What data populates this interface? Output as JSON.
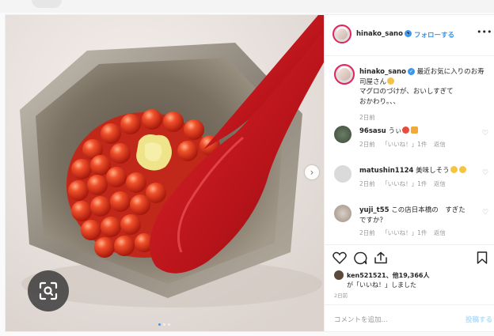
{
  "post": {
    "username": "hinako_sano",
    "follow_label": "フォローする",
    "separator": "•",
    "more_icon": "more-dots-icon",
    "image": {
      "image_dots": 3,
      "active_dot": 0
    },
    "caption": {
      "username": "hinako_sano",
      "text": "最近お気に入りのお寿司屋さん",
      "text_line2": "マグロのづけが、おいしすぎて",
      "text_line3": "おかわり。、、",
      "time": "2日前"
    },
    "comments": [
      {
        "username": "96sasu",
        "text": "うぃ",
        "time": "2日前",
        "likes": "「いいね！」1件",
        "reply": "返信"
      },
      {
        "username": "matushin1124",
        "text": "美味しそう",
        "time": "2日前",
        "likes": "「いいね！」1件",
        "reply": "返信"
      },
      {
        "username": "yuji_t55",
        "text": "この店日本橋の　すぎた　ですか？",
        "time": "2日前",
        "likes": "「いいね！」1件",
        "reply": "返信"
      }
    ],
    "likes": {
      "line1_user": "ken521521",
      "line1_rest": "、他19,366人",
      "line2": "が「いいね！」しました"
    },
    "date": "2日前",
    "comment_placeholder": "コメントを追加...",
    "post_button": "投稿する"
  },
  "colors": {
    "accent": "#3897f0",
    "border": "#efefef",
    "meta_text": "#999999",
    "post_disabled": "#b2dffc"
  }
}
